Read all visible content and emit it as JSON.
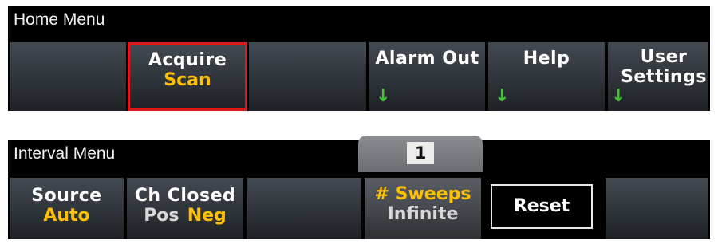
{
  "home_menu": {
    "title": "Home Menu",
    "softkeys": [
      {
        "label": ""
      },
      {
        "label": "Acquire",
        "value": "Scan",
        "selected": true
      },
      {
        "label": ""
      },
      {
        "label": "Alarm Out",
        "has_submenu": true
      },
      {
        "label": "Help",
        "has_submenu": true
      },
      {
        "label_line1": "User",
        "label_line2": "Settings",
        "has_submenu": true
      }
    ]
  },
  "interval_menu": {
    "title": "Interval Menu",
    "tab_number": "1",
    "softkeys": [
      {
        "label": "Source",
        "value": "Auto"
      },
      {
        "label": "Ch Closed",
        "option_inactive": "Pos",
        "option_active": "Neg"
      },
      {
        "label": ""
      },
      {
        "label": "# Sweeps",
        "value": "Infinite"
      },
      {
        "label": "Reset"
      },
      {
        "label": ""
      }
    ]
  },
  "colors": {
    "accent_value": "#ffc000",
    "submenu_arrow": "#48c23a",
    "selection_border": "#e01a1a",
    "menu_background": "#000000"
  },
  "icons": {
    "submenu_arrow": "down-arrow-icon"
  }
}
